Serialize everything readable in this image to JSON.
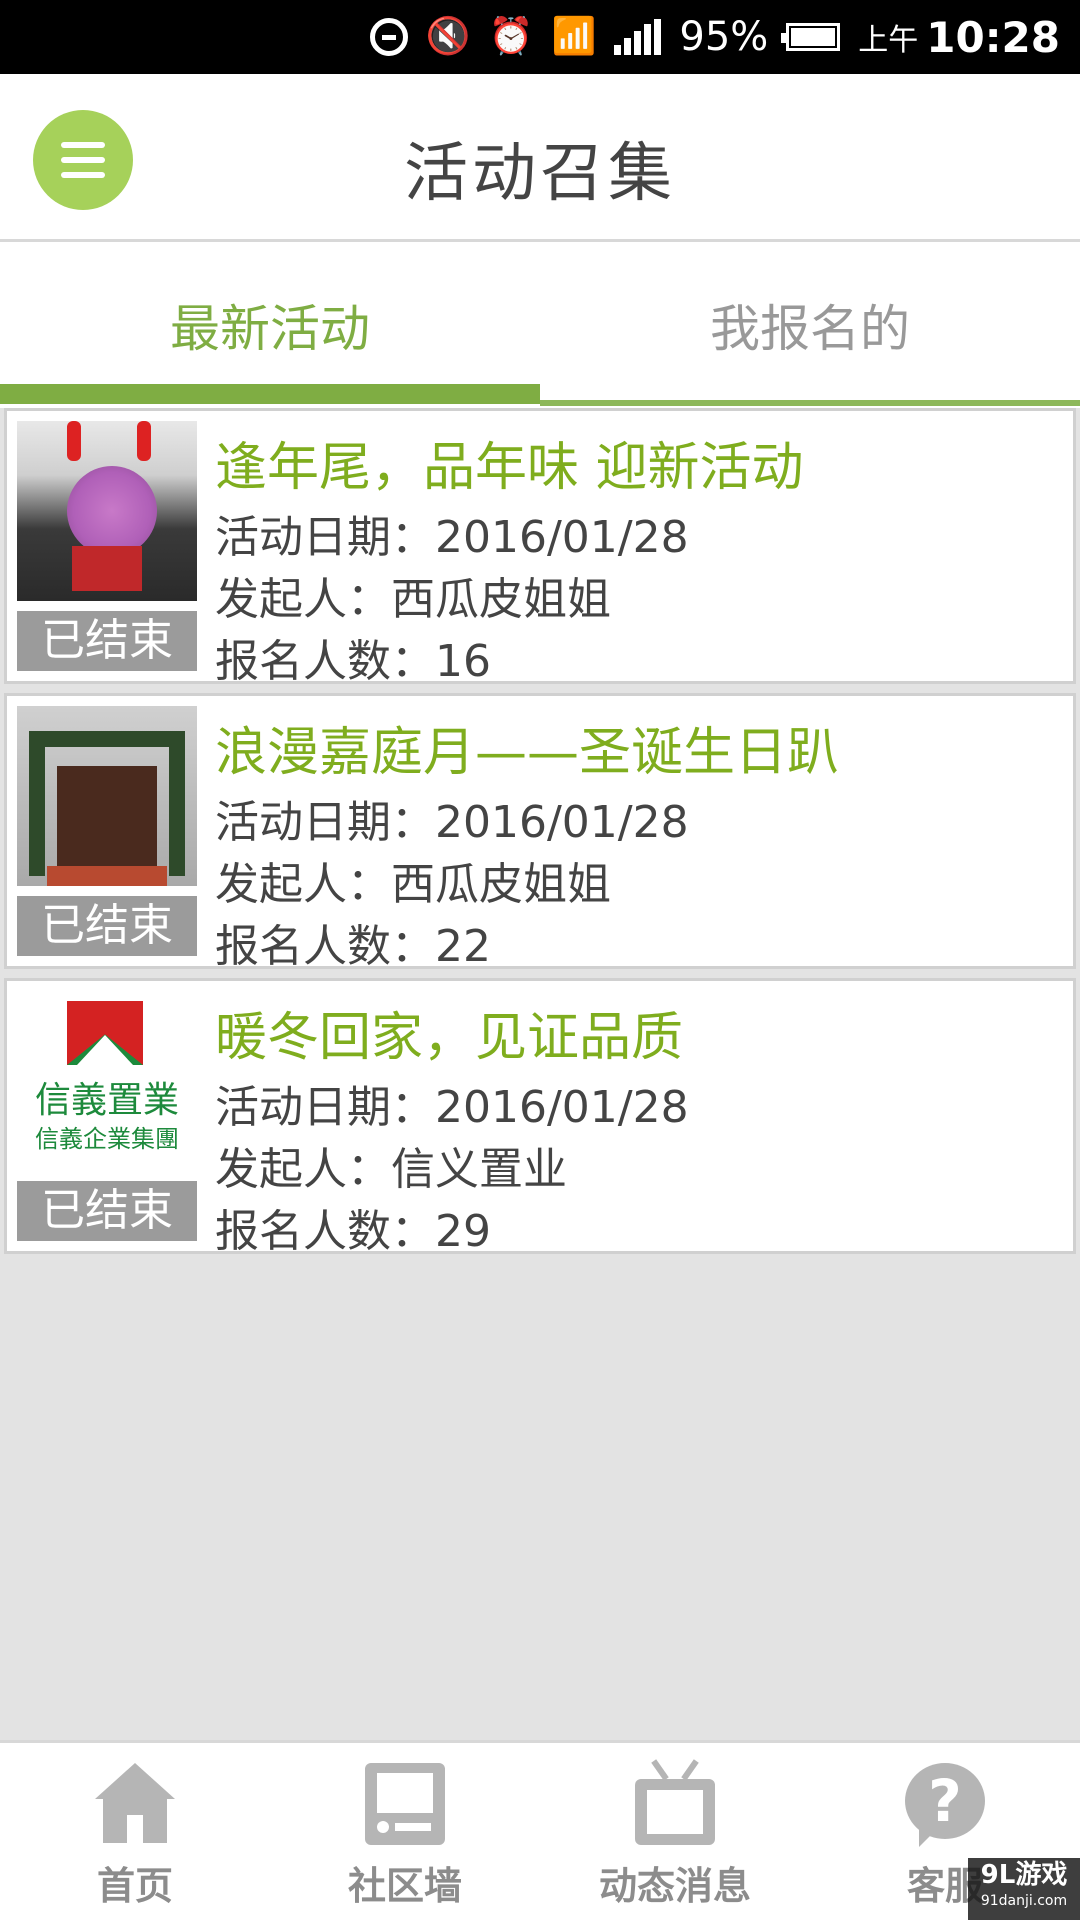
{
  "status_bar": {
    "battery_percent": "95%",
    "ampm": "上午",
    "time": "10:28",
    "icons": [
      "do-not-disturb-icon",
      "mute-icon",
      "alarm-icon",
      "wifi-icon",
      "signal-icon",
      "battery-charging-icon"
    ]
  },
  "header": {
    "title": "活动召集",
    "menu_icon": "hamburger-menu-icon",
    "menu_color": "#a6d15a"
  },
  "tabs": [
    {
      "label": "最新活动",
      "active": true
    },
    {
      "label": "我报名的",
      "active": false
    }
  ],
  "accent_color": "#7fad43",
  "activities": [
    {
      "title": "逢年尾，品年味 迎新活动",
      "date_line": "活动日期：2016/01/28",
      "organizer_line": "发起人：西瓜皮姐姐",
      "signups_line": "报名人数：16",
      "status": "已结束"
    },
    {
      "title": "浪漫嘉庭月——圣诞生日趴",
      "date_line": "活动日期：2016/01/28",
      "organizer_line": "发起人：西瓜皮姐姐",
      "signups_line": "报名人数：22",
      "status": "已结束"
    },
    {
      "title": "暖冬回家，见证品质",
      "date_line": "活动日期：2016/01/28",
      "organizer_line": "发起人：信义置业",
      "signups_line": "报名人数：29",
      "status": "已结束",
      "logo_text": "信義置業",
      "logo_subtext": "信義企業集團"
    }
  ],
  "bottom_nav": [
    {
      "label": "首页",
      "icon": "home-icon"
    },
    {
      "label": "社区墙",
      "icon": "community-wall-icon"
    },
    {
      "label": "动态消息",
      "icon": "tv-news-icon"
    },
    {
      "label": "客服",
      "icon": "help-icon"
    }
  ],
  "watermark": {
    "line1": "9L游戏",
    "line2": "91danji.com"
  }
}
